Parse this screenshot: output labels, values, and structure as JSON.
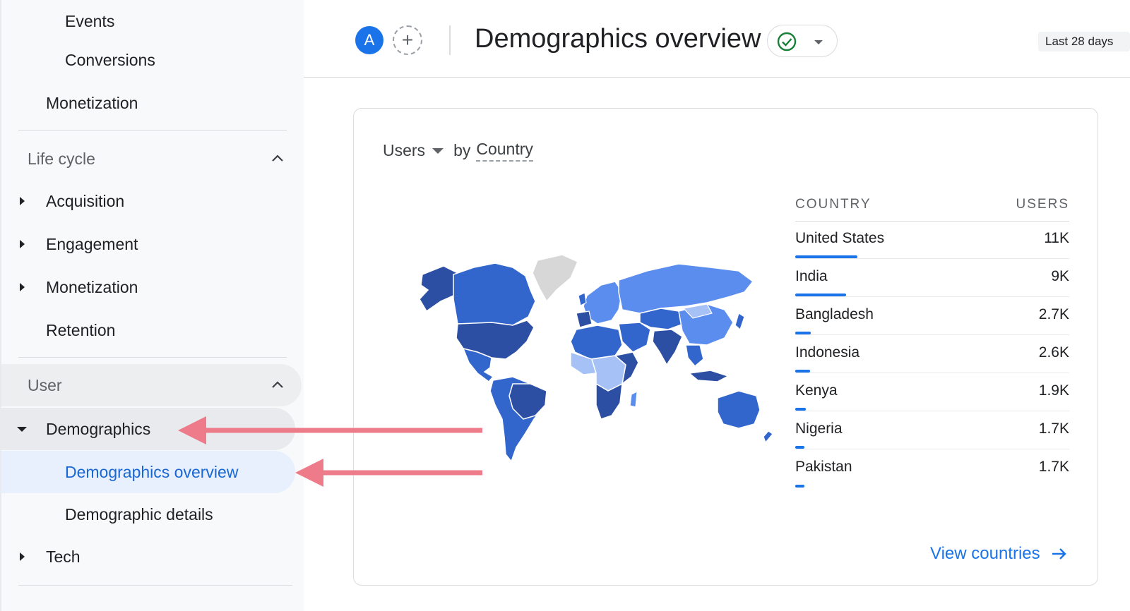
{
  "sidebar": {
    "items_top": [
      {
        "label": "Events"
      },
      {
        "label": "Conversions"
      },
      {
        "label": "Monetization"
      }
    ],
    "lifecycle": {
      "title": "Life cycle",
      "items": [
        {
          "label": "Acquisition"
        },
        {
          "label": "Engagement"
        },
        {
          "label": "Monetization"
        },
        {
          "label": "Retention"
        }
      ]
    },
    "user": {
      "title": "User",
      "demographics": "Demographics",
      "demographics_overview": "Demographics overview",
      "demographic_details": "Demographic details",
      "tech": "Tech"
    }
  },
  "header": {
    "avatar_letter": "A",
    "add_symbol": "+",
    "title": "Demographics overview",
    "date_range": "Last 28 days"
  },
  "card": {
    "metric": "Users",
    "by_prefix": "by",
    "dimension": "Country",
    "col_country": "COUNTRY",
    "col_users": "USERS",
    "rows": [
      {
        "country": "United States",
        "users": "11K"
      },
      {
        "country": "India",
        "users": "9K"
      },
      {
        "country": "Bangladesh",
        "users": "2.7K"
      },
      {
        "country": "Indonesia",
        "users": "2.6K"
      },
      {
        "country": "Kenya",
        "users": "1.9K"
      },
      {
        "country": "Nigeria",
        "users": "1.7K"
      },
      {
        "country": "Pakistan",
        "users": "1.7K"
      }
    ],
    "row_share": [
      1.0,
      0.82,
      0.25,
      0.24,
      0.17,
      0.15,
      0.15
    ],
    "view_link": "View countries"
  },
  "colors": {
    "accent": "#1a73e8",
    "map_dark": "#2c4fa3",
    "map_mid": "#3366cc",
    "map_light": "#5b8def",
    "map_pale": "#a6c1f5",
    "map_none": "#d7d7d7",
    "arrow": "#ee7b8a"
  }
}
